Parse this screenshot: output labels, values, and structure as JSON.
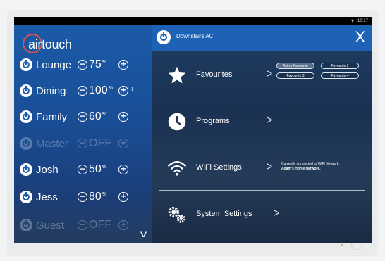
{
  "status_bar": {
    "time": "10:17"
  },
  "app": {
    "logo_text": "airtouch"
  },
  "zones": [
    {
      "name": "Lounge",
      "value": "75",
      "unit": "%",
      "extra": ""
    },
    {
      "name": "Dining",
      "value": "100",
      "unit": "%",
      "extra": "✈"
    },
    {
      "name": "Family",
      "value": "60",
      "unit": "%",
      "extra": ""
    },
    {
      "name": "Master",
      "value": "OFF",
      "unit": "",
      "extra": ""
    },
    {
      "name": "Josh",
      "value": "50",
      "unit": "%",
      "extra": ""
    },
    {
      "name": "Jess",
      "value": "80",
      "unit": "%",
      "extra": ""
    },
    {
      "name": "Guest",
      "value": "OFF",
      "unit": "",
      "extra": ""
    }
  ],
  "header": {
    "title": "Downstairs AC",
    "close": "X"
  },
  "menu": {
    "favourites": {
      "label": "Favourites",
      "arrow": ">"
    },
    "programs": {
      "label": "Programs",
      "arrow": ">"
    },
    "wifi": {
      "label": "WiFi Settings",
      "arrow": ">"
    },
    "system": {
      "label": "System Settings",
      "arrow": ">"
    }
  },
  "favourite_buttons": [
    "Active Favourite",
    "Favourite 2",
    "Favourite 3",
    "Favourite 4"
  ],
  "wifi_info": {
    "line1": "Currently connected to WiFi Network:",
    "network": "Adam's Home Network."
  },
  "colors": {
    "accent": "#1d62b5",
    "logo_ring": "#d9534a"
  }
}
